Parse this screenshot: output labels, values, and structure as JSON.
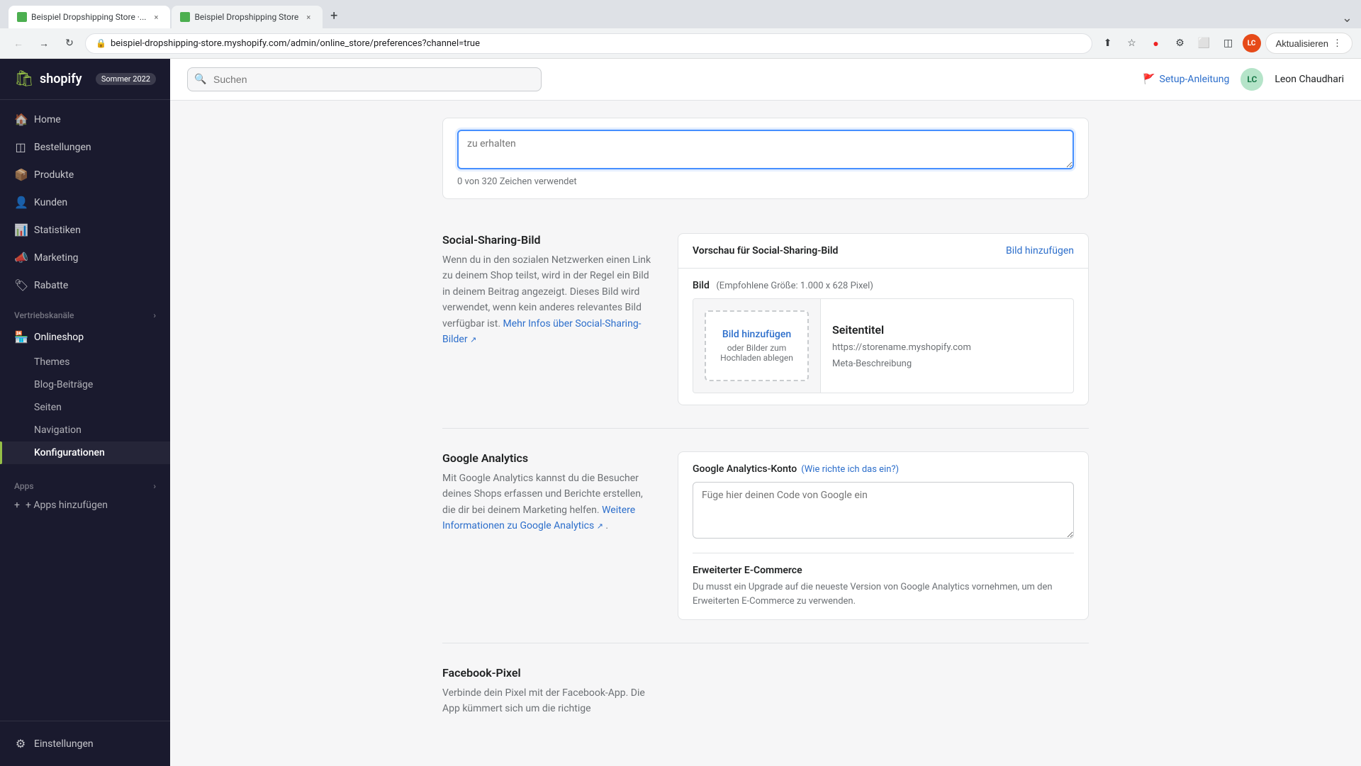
{
  "browser": {
    "tabs": [
      {
        "id": "tab1",
        "title": "Beispiel Dropshipping Store ·...",
        "active": true,
        "favicon": "green"
      },
      {
        "id": "tab2",
        "title": "Beispiel Dropshipping Store",
        "active": false,
        "favicon": "green"
      }
    ],
    "url": "beispiel-dropshipping-store.myshopify.com/admin/online_store/preferences?channel=true",
    "update_button": "Aktualisieren",
    "user_initials": "LC",
    "user_name": "Leon Chaudhari"
  },
  "shopify": {
    "logo_text": "shopify",
    "season_badge": "Sommer 2022",
    "search_placeholder": "Suchen"
  },
  "sidebar": {
    "nav_items": [
      {
        "id": "home",
        "label": "Home",
        "icon": "🏠"
      },
      {
        "id": "bestellungen",
        "label": "Bestellungen",
        "icon": "📋"
      },
      {
        "id": "produkte",
        "label": "Produkte",
        "icon": "📦"
      },
      {
        "id": "kunden",
        "label": "Kunden",
        "icon": "👤"
      },
      {
        "id": "statistiken",
        "label": "Statistiken",
        "icon": "📊"
      },
      {
        "id": "marketing",
        "label": "Marketing",
        "icon": "📣"
      },
      {
        "id": "rabatte",
        "label": "Rabatte",
        "icon": "🏷"
      }
    ],
    "vertriebskanaele_label": "Vertriebskanäle",
    "vertriebskanaele_icon": "›",
    "online_store": {
      "label": "Onlineshop",
      "sub_items": [
        {
          "id": "themes",
          "label": "Themes"
        },
        {
          "id": "blog",
          "label": "Blog-Beiträge"
        },
        {
          "id": "seiten",
          "label": "Seiten"
        },
        {
          "id": "navigation",
          "label": "Navigation"
        },
        {
          "id": "konfigurationen",
          "label": "Konfigurationen",
          "active": true
        }
      ]
    },
    "apps_label": "Apps",
    "apps_icon": "›",
    "add_apps": "+ Apps hinzufügen",
    "einstellungen": "Einstellungen"
  },
  "topbar": {
    "search_placeholder": "Suchen",
    "setup_link": "Setup-Anleitung",
    "user_initials": "LC",
    "user_name": "Leon Chaudhari"
  },
  "page": {
    "sections": {
      "char_counter": {
        "text": "0 von 320 Zeichen verwendet"
      },
      "social_sharing": {
        "left_title": "Social-Sharing-Bild",
        "left_desc": "Wenn du in den sozialen Netzwerken einen Link zu deinem Shop teilst, wird in der Regel ein Bild in deinem Beitrag angezeigt. Dieses Bild wird verwendet, wenn kein anderes relevantes Bild verfügbar ist.",
        "left_link_text": "Mehr Infos über Social-Sharing-Bilder",
        "right_title": "Vorschau für Social-Sharing-Bild",
        "add_image_link": "Bild hinzufügen",
        "image_label": "Bild",
        "image_size_hint": "(Empfohlene Größe: 1.000 x 628 Pixel)",
        "drop_label": "Bild hinzufügen",
        "drop_sub": "oder Bilder zum Hochladen ablegen",
        "preview_title": "Seitentitel",
        "preview_url": "https://storename.myshopify.com",
        "preview_desc": "Meta-Beschreibung"
      },
      "google_analytics": {
        "left_title": "Google Analytics",
        "left_desc": "Mit Google Analytics kannst du die Besucher deines Shops erfassen und Berichte erstellen, die dir bei deinem Marketing helfen.",
        "left_link_text": "Weitere Informationen zu Google Analytics",
        "right_title": "Google Analytics-Konto",
        "right_help_link": "(Wie richte ich das ein?)",
        "textarea_placeholder": "Füge hier deinen Code von Google ein",
        "ecommerce_title": "Erweiterter E-Commerce",
        "ecommerce_desc": "Du musst ein Upgrade auf die neueste Version von Google Analytics vornehmen, um den Erweiterten E-Commerce zu verwenden."
      },
      "facebook_pixel": {
        "left_title": "Facebook-Pixel",
        "left_desc": "Verbinde dein Pixel mit der Facebook-App. Die App kümmert sich um die richtige"
      }
    }
  }
}
